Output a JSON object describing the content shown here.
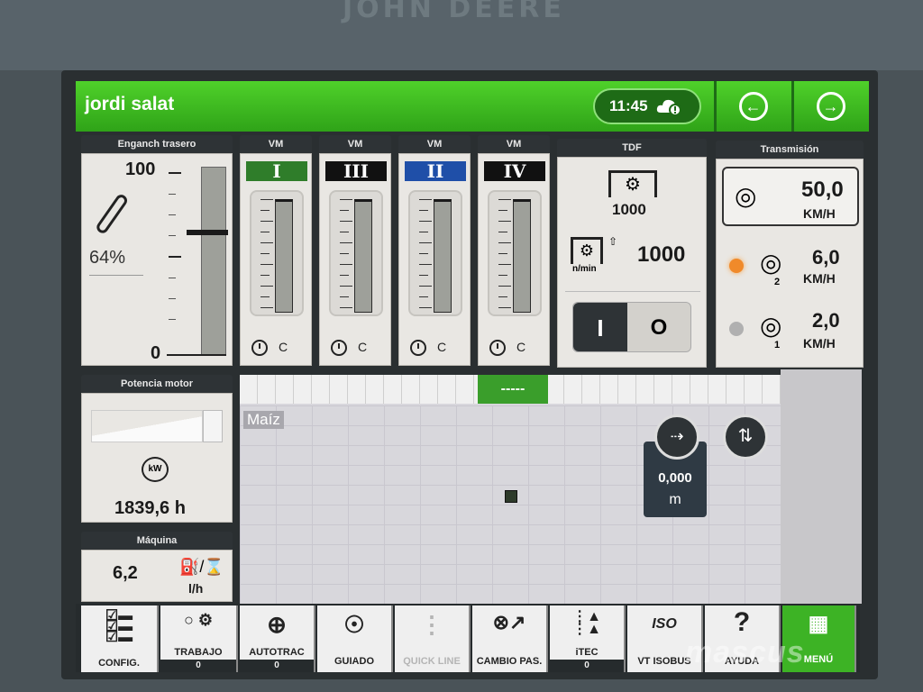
{
  "brand": "JOHN DEERE",
  "header": {
    "title": "jordi salat",
    "time": "11:45"
  },
  "hitch": {
    "title": "Enganch trasero",
    "max": "100",
    "percent": "64%",
    "min": "0"
  },
  "vm": [
    {
      "title": "VM",
      "roman": "I",
      "color": "#2f7d2a",
      "c": "C"
    },
    {
      "title": "VM",
      "roman": "III",
      "color": "#111111",
      "c": "C"
    },
    {
      "title": "VM",
      "roman": "II",
      "color": "#1f4fa8",
      "c": "C"
    },
    {
      "title": "VM",
      "roman": "IV",
      "color": "#111111",
      "c": "C"
    }
  ],
  "pto": {
    "title": "TDF",
    "target": "1000",
    "unit": "n/min",
    "actual": "1000",
    "switch_on": "I",
    "switch_off": "O"
  },
  "transmission": {
    "title": "Transmisión",
    "speed1": "50,0",
    "unit1": "KM/H",
    "speed2": "6,0",
    "unit2": "KM/H",
    "gear2": "2",
    "speed3": "2,0",
    "unit3": "KM/H",
    "gear3": "1"
  },
  "engine": {
    "title": "Potencia motor",
    "unit_icon": "kW",
    "hours": "1839,6 h"
  },
  "machine": {
    "title": "Máquina",
    "value": "6,2",
    "unit": "l/h"
  },
  "map": {
    "crop": "Maíz",
    "strip_label": "-----",
    "distance": "0,000",
    "distance_unit": "m"
  },
  "bottom_tabs": [
    {
      "label": "CONFIG.",
      "count": ""
    },
    {
      "label": "TRABAJO",
      "count": "0"
    },
    {
      "label": "AUTOTRAC",
      "count": "0"
    },
    {
      "label": "GUIADO",
      "count": ""
    },
    {
      "label": "QUICK LINE",
      "count": ""
    },
    {
      "label": "CAMBIO PAS.",
      "count": ""
    },
    {
      "label": "iTEC",
      "count": "0"
    },
    {
      "label": "VT ISOBUS",
      "count": ""
    },
    {
      "label": "AYUDA",
      "count": ""
    },
    {
      "label": "MENÚ",
      "count": ""
    }
  ],
  "watermark": "mascus"
}
